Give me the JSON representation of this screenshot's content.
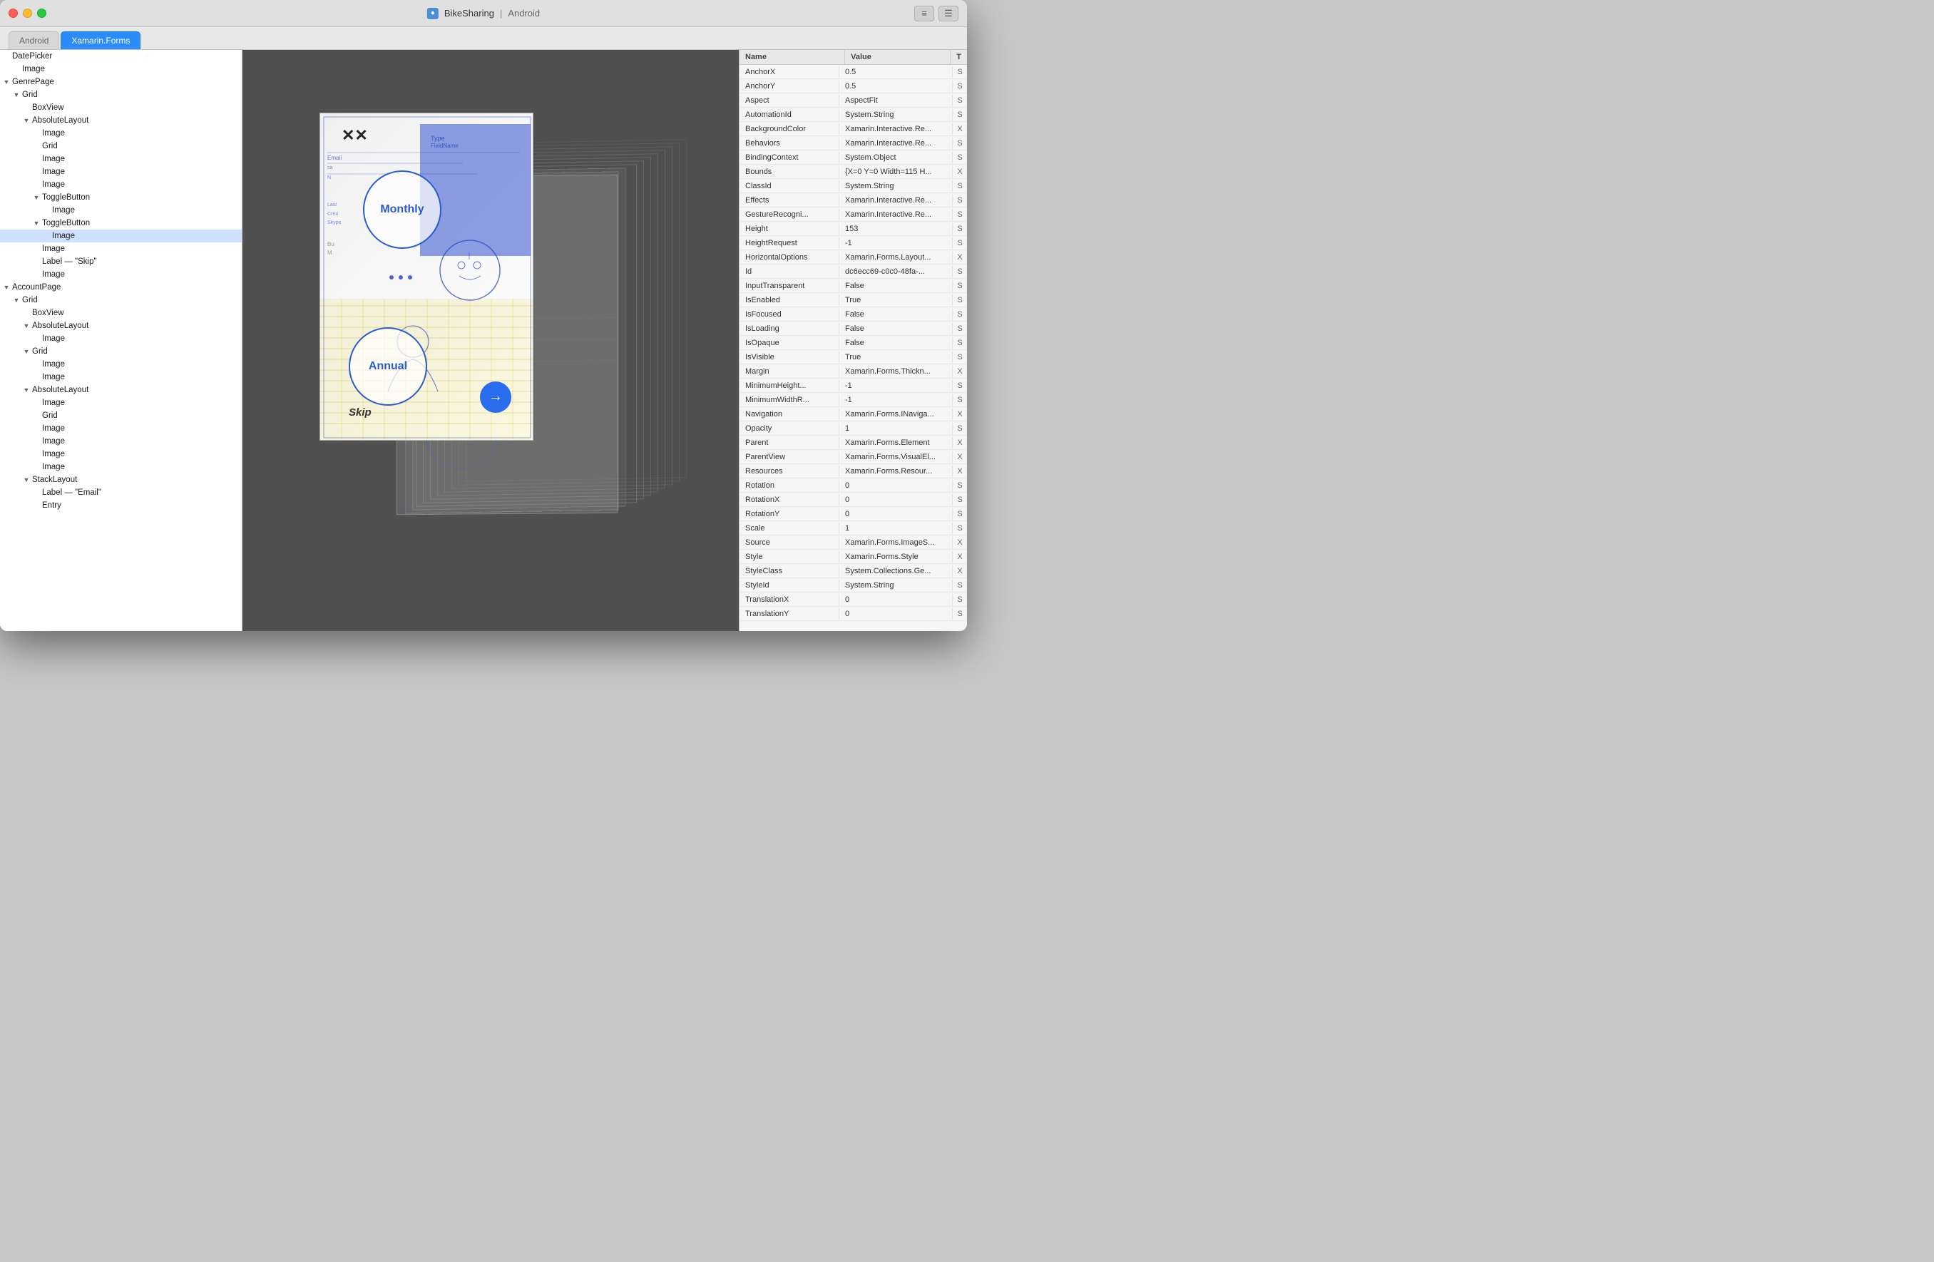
{
  "window": {
    "title": "BikeSharing",
    "platform": "Android",
    "traffic_lights": [
      "close",
      "minimize",
      "maximize"
    ]
  },
  "titlebar": {
    "icon_label": "●",
    "title": "BikeSharing",
    "separator": "|",
    "subtitle": "Android",
    "btn1": "≡",
    "btn2": "☰"
  },
  "tabs": [
    {
      "label": "Android",
      "state": "inactive"
    },
    {
      "label": "Xamarin.Forms",
      "state": "highlighted"
    }
  ],
  "tree": [
    {
      "indent": 0,
      "arrow": "",
      "label": "DatePicker"
    },
    {
      "indent": 1,
      "arrow": "",
      "label": "Image"
    },
    {
      "indent": 0,
      "arrow": "▼",
      "label": "GenrePage"
    },
    {
      "indent": 1,
      "arrow": "▼",
      "label": "Grid"
    },
    {
      "indent": 2,
      "arrow": "",
      "label": "BoxView"
    },
    {
      "indent": 2,
      "arrow": "▼",
      "label": "AbsoluteLayout"
    },
    {
      "indent": 3,
      "arrow": "",
      "label": "Image"
    },
    {
      "indent": 3,
      "arrow": "",
      "label": "Grid"
    },
    {
      "indent": 3,
      "arrow": "",
      "label": "Image"
    },
    {
      "indent": 3,
      "arrow": "",
      "label": "Image"
    },
    {
      "indent": 3,
      "arrow": "",
      "label": "Image"
    },
    {
      "indent": 3,
      "arrow": "▼",
      "label": "ToggleButton"
    },
    {
      "indent": 4,
      "arrow": "",
      "label": "Image"
    },
    {
      "indent": 3,
      "arrow": "▼",
      "label": "ToggleButton"
    },
    {
      "indent": 4,
      "arrow": "",
      "label": "Image",
      "selected": true
    },
    {
      "indent": 3,
      "arrow": "",
      "label": "Image"
    },
    {
      "indent": 3,
      "arrow": "",
      "label": "Label — \"Skip\""
    },
    {
      "indent": 3,
      "arrow": "",
      "label": "Image"
    },
    {
      "indent": 0,
      "arrow": "▼",
      "label": "AccountPage"
    },
    {
      "indent": 1,
      "arrow": "▼",
      "label": "Grid"
    },
    {
      "indent": 2,
      "arrow": "",
      "label": "BoxView"
    },
    {
      "indent": 2,
      "arrow": "▼",
      "label": "AbsoluteLayout"
    },
    {
      "indent": 3,
      "arrow": "",
      "label": "Image"
    },
    {
      "indent": 2,
      "arrow": "▼",
      "label": "Grid"
    },
    {
      "indent": 3,
      "arrow": "",
      "label": "Image"
    },
    {
      "indent": 3,
      "arrow": "",
      "label": "Image"
    },
    {
      "indent": 2,
      "arrow": "▼",
      "label": "AbsoluteLayout"
    },
    {
      "indent": 3,
      "arrow": "",
      "label": "Image"
    },
    {
      "indent": 3,
      "arrow": "",
      "label": "Grid"
    },
    {
      "indent": 3,
      "arrow": "",
      "label": "Image"
    },
    {
      "indent": 3,
      "arrow": "",
      "label": "Image"
    },
    {
      "indent": 3,
      "arrow": "",
      "label": "Image"
    },
    {
      "indent": 3,
      "arrow": "",
      "label": "Image"
    },
    {
      "indent": 2,
      "arrow": "▼",
      "label": "StackLayout"
    },
    {
      "indent": 3,
      "arrow": "",
      "label": "Label — \"Email\""
    },
    {
      "indent": 3,
      "arrow": "",
      "label": "Entry"
    }
  ],
  "properties": {
    "headers": [
      "Name",
      "Value",
      "T"
    ],
    "rows": [
      {
        "name": "AnchorX",
        "value": "0.5",
        "type": "S"
      },
      {
        "name": "AnchorY",
        "value": "0.5",
        "type": "S"
      },
      {
        "name": "Aspect",
        "value": "AspectFit",
        "type": "S"
      },
      {
        "name": "AutomationId",
        "value": "System.String",
        "type": "S"
      },
      {
        "name": "BackgroundColor",
        "value": "Xamarin.Interactive.Re...",
        "type": "X"
      },
      {
        "name": "Behaviors",
        "value": "Xamarin.Interactive.Re...",
        "type": "S"
      },
      {
        "name": "BindingContext",
        "value": "System.Object",
        "type": "S"
      },
      {
        "name": "Bounds",
        "value": "{X=0 Y=0 Width=115 H...",
        "type": "X"
      },
      {
        "name": "ClassId",
        "value": "System.String",
        "type": "S"
      },
      {
        "name": "Effects",
        "value": "Xamarin.Interactive.Re...",
        "type": "S"
      },
      {
        "name": "GestureRecogni...",
        "value": "Xamarin.Interactive.Re...",
        "type": "S"
      },
      {
        "name": "Height",
        "value": "153",
        "type": "S"
      },
      {
        "name": "HeightRequest",
        "value": "-1",
        "type": "S"
      },
      {
        "name": "HorizontalOptions",
        "value": "Xamarin.Forms.Layout...",
        "type": "X"
      },
      {
        "name": "Id",
        "value": "dc6ecc69-c0c0-48fa-...",
        "type": "S"
      },
      {
        "name": "InputTransparent",
        "value": "False",
        "type": "S"
      },
      {
        "name": "IsEnabled",
        "value": "True",
        "type": "S"
      },
      {
        "name": "IsFocused",
        "value": "False",
        "type": "S"
      },
      {
        "name": "IsLoading",
        "value": "False",
        "type": "S"
      },
      {
        "name": "IsOpaque",
        "value": "False",
        "type": "S"
      },
      {
        "name": "IsVisible",
        "value": "True",
        "type": "S"
      },
      {
        "name": "Margin",
        "value": "Xamarin.Forms.Thickn...",
        "type": "X"
      },
      {
        "name": "MinimumHeight...",
        "value": "-1",
        "type": "S"
      },
      {
        "name": "MinimumWidthR...",
        "value": "-1",
        "type": "S"
      },
      {
        "name": "Navigation",
        "value": "Xamarin.Forms.INaviga...",
        "type": "X"
      },
      {
        "name": "Opacity",
        "value": "1",
        "type": "S"
      },
      {
        "name": "Parent",
        "value": "Xamarin.Forms.Element",
        "type": "X"
      },
      {
        "name": "ParentView",
        "value": "Xamarin.Forms.VisualEl...",
        "type": "X"
      },
      {
        "name": "Resources",
        "value": "Xamarin.Forms.Resour...",
        "type": "X"
      },
      {
        "name": "Rotation",
        "value": "0",
        "type": "S"
      },
      {
        "name": "RotationX",
        "value": "0",
        "type": "S"
      },
      {
        "name": "RotationY",
        "value": "0",
        "type": "S"
      },
      {
        "name": "Scale",
        "value": "1",
        "type": "S"
      },
      {
        "name": "Source",
        "value": "Xamarin.Forms.ImageS...",
        "type": "X"
      },
      {
        "name": "Style",
        "value": "Xamarin.Forms.Style",
        "type": "X"
      },
      {
        "name": "StyleClass",
        "value": "System.Collections.Ge...",
        "type": "X"
      },
      {
        "name": "StyleId",
        "value": "System.String",
        "type": "S"
      },
      {
        "name": "TranslationX",
        "value": "0",
        "type": "S"
      },
      {
        "name": "TranslationY",
        "value": "0",
        "type": "S"
      }
    ]
  }
}
